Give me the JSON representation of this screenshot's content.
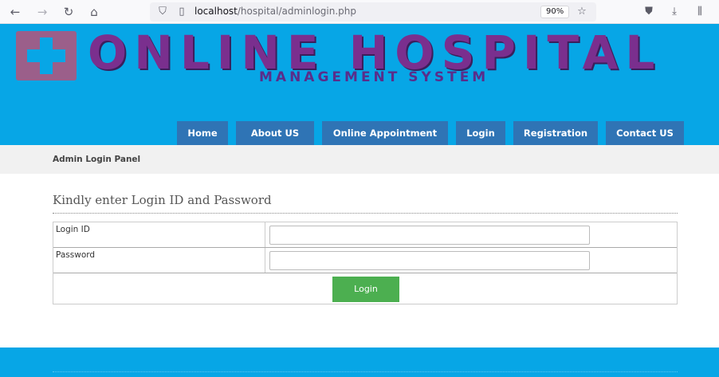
{
  "browser": {
    "url_host": "localhost",
    "url_path": "/hospital/adminlogin.php",
    "zoom": "90%",
    "icons": [
      "back-icon",
      "forward-icon",
      "reload-icon",
      "home-icon",
      "shield-icon",
      "page-icon",
      "bookmark-star-icon",
      "pocket-icon",
      "download-icon",
      "library-icon"
    ]
  },
  "header": {
    "title": "ONLINE HOSPITAL",
    "subtitle": "MANAGEMENT SYSTEM",
    "colors": {
      "background": "#07a6e6",
      "title": "#7a2f8e",
      "menu": "#2f74b5"
    }
  },
  "menu": {
    "items": [
      {
        "label": "Home"
      },
      {
        "label": "About US"
      },
      {
        "label": "Online Appointment"
      },
      {
        "label": "Login"
      },
      {
        "label": "Registration"
      },
      {
        "label": "Contact US"
      }
    ]
  },
  "panel": {
    "title": "Admin Login Panel"
  },
  "form": {
    "heading": "Kindly enter Login ID and Password",
    "login_id_label": "Login ID",
    "login_id_value": "",
    "password_label": "Password",
    "password_value": "",
    "submit_label": "Login",
    "button_color": "#4caf50"
  }
}
